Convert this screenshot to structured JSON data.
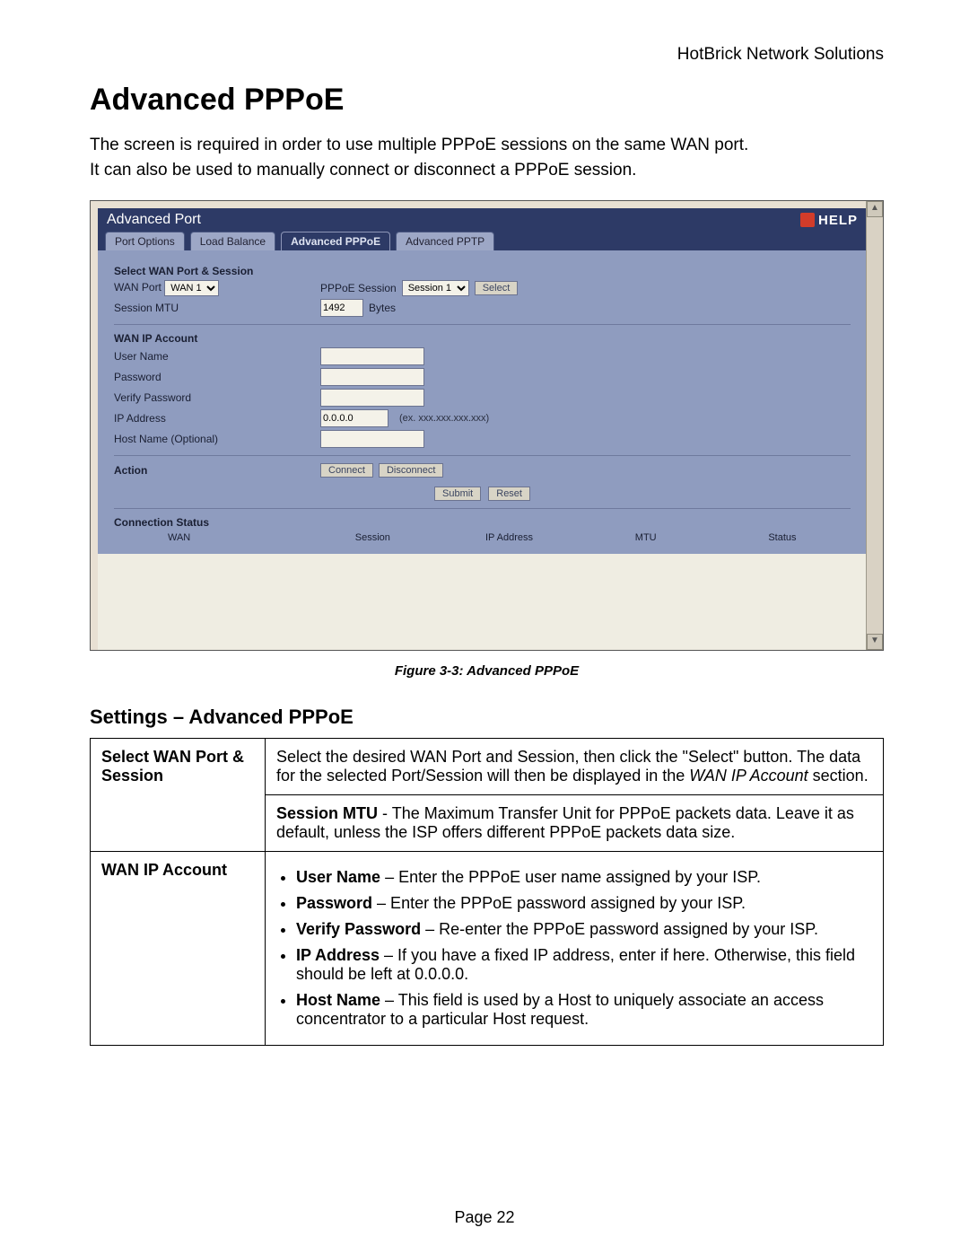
{
  "header": {
    "company": "HotBrick Network Solutions"
  },
  "title": "Advanced PPPoE",
  "intro": {
    "line1": "The screen is required in order to use multiple PPPoE sessions on the same WAN port.",
    "line2": "It can also be used to manually connect or disconnect a PPPoE session."
  },
  "screenshot": {
    "panel_title": "Advanced Port",
    "help_label": "HELP",
    "tabs": {
      "port_options": "Port Options",
      "load_balance": "Load Balance",
      "adv_pppoe": "Advanced PPPoE",
      "adv_pptp": "Advanced PPTP"
    },
    "select_section": {
      "heading": "Select WAN Port & Session",
      "wan_port_label": "WAN Port",
      "wan_port_value": "WAN 1",
      "pppoe_session_label": "PPPoE Session",
      "pppoe_session_value": "Session 1",
      "select_btn": "Select",
      "mtu_label": "Session MTU",
      "mtu_value": "1492",
      "mtu_unit": "Bytes"
    },
    "account_section": {
      "heading": "WAN IP Account",
      "user_name": "User Name",
      "password": "Password",
      "verify_password": "Verify Password",
      "ip_address": "IP Address",
      "ip_value": "0.0.0.0",
      "ip_hint": "(ex. xxx.xxx.xxx.xxx)",
      "host_name": "Host Name (Optional)"
    },
    "action_section": {
      "heading": "Action",
      "connect": "Connect",
      "disconnect": "Disconnect",
      "submit": "Submit",
      "reset": "Reset"
    },
    "status_section": {
      "heading": "Connection Status",
      "col_wan": "WAN",
      "col_session": "Session",
      "col_ip": "IP Address",
      "col_mtu": "MTU",
      "col_status": "Status"
    }
  },
  "figure_caption": "Figure 3-3: Advanced PPPoE",
  "settings_heading": "Settings – Advanced PPPoE",
  "settings_table": {
    "row1": {
      "key": "Select WAN Port & Session",
      "para1_prefix": "Select the desired WAN Port and Session, then click the \"Select\" button. The data for the selected Port/Session will then be displayed in the ",
      "para1_italic": "WAN IP Account",
      "para1_suffix": " section.",
      "para2_bold": "Session MTU",
      "para2_rest": " - The Maximum Transfer Unit for PPPoE packets data. Leave it as default, unless the ISP offers different PPPoE packets data size."
    },
    "row2": {
      "key": "WAN IP Account",
      "items": {
        "user_name_b": "User Name",
        "user_name_t": " – Enter the PPPoE user name assigned by your ISP.",
        "password_b": "Password",
        "password_t": " – Enter the PPPoE password assigned by your ISP.",
        "verify_b": "Verify Password",
        "verify_t": " – Re-enter the PPPoE password assigned by your ISP.",
        "ip_b": "IP Address",
        "ip_t": " – If you have a fixed IP address, enter if here. Otherwise, this field should be left at 0.0.0.0.",
        "host_b": "Host Name",
        "host_t": " – This field is used by a Host to uniquely associate an access concentrator to a particular Host request."
      }
    }
  },
  "page_number": "Page 22"
}
